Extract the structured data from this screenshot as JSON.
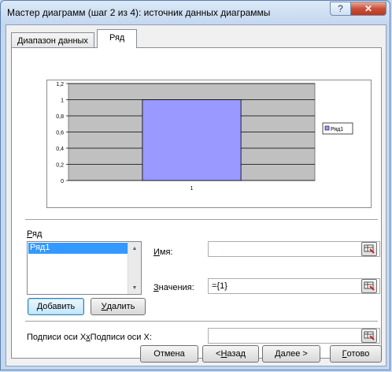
{
  "window": {
    "title": "Мастер диаграмм (шаг 2 из 4): источник данных диаграммы",
    "help_label": "?",
    "close_label": "✕"
  },
  "tabs": [
    {
      "label": "Диапазон данных",
      "active": false
    },
    {
      "label": "Ряд",
      "active": true
    }
  ],
  "chart_data": {
    "type": "bar",
    "categories": [
      "1"
    ],
    "series": [
      {
        "name": "Ряд1",
        "values": [
          1
        ]
      }
    ],
    "ylim": [
      0,
      1.2
    ],
    "yticks": [
      "0",
      "0,2",
      "0,4",
      "0,6",
      "0,8",
      "1",
      "1,2"
    ],
    "grid": true,
    "legend": "right",
    "colors": {
      "bar": "#9999ff",
      "plot_bg": "#c0c0c0"
    }
  },
  "series_section": {
    "label": "Ряд",
    "items": [
      "Ряд1"
    ],
    "add_button": "Добавить",
    "remove_button": "Удалить"
  },
  "fields": {
    "name_label": "Имя:",
    "name_value": "",
    "values_label": "Значения:",
    "values_value": "={1}",
    "xlabels_label": "Подписи оси X:",
    "xlabels_value": ""
  },
  "footer": {
    "cancel": "Отмена",
    "back": "< Назад",
    "next": "Далее >",
    "finish": "Готово"
  }
}
